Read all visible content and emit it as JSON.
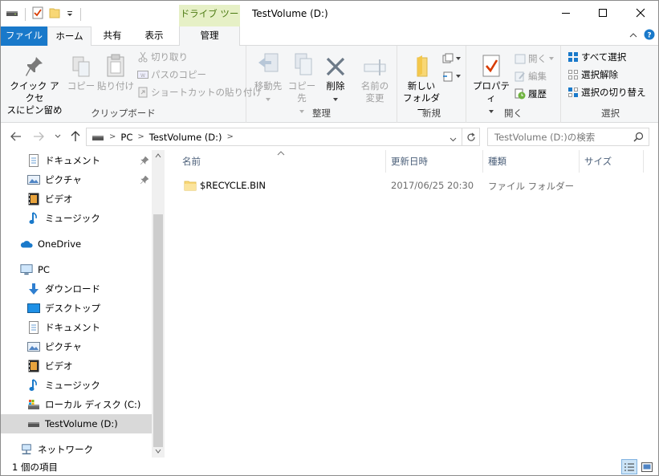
{
  "window": {
    "title": "TestVolume (D:)",
    "context_tab_title": "ドライブ ツール"
  },
  "tabs": {
    "file": "ファイル",
    "home": "ホーム",
    "share": "共有",
    "view": "表示",
    "manage": "管理"
  },
  "ribbon": {
    "clipboard": {
      "label": "クリップボード",
      "pin_quick_access": [
        "クイック アクセ",
        "スにピン留め"
      ],
      "copy": "コピー",
      "paste": "貼り付け",
      "cut": "切り取り",
      "copy_path": "パスのコピー",
      "paste_shortcut": "ショートカットの貼り付け"
    },
    "organize": {
      "label": "整理",
      "move_to": "移動先",
      "copy_to": "コピー先",
      "delete": "削除",
      "rename": [
        "名前の",
        "変更"
      ]
    },
    "new": {
      "label": "新規",
      "new_folder": [
        "新しい",
        "フォルダー"
      ]
    },
    "open": {
      "label": "開く",
      "properties": "プロパティ",
      "open": "開く",
      "edit": "編集",
      "history": "履歴"
    },
    "select": {
      "label": "選択",
      "select_all": "すべて選択",
      "select_none": "選択解除",
      "invert": "選択の切り替え"
    }
  },
  "address": {
    "crumbs": [
      "PC",
      "TestVolume (D:)"
    ],
    "search_placeholder": "TestVolume (D:)の検索"
  },
  "nav": {
    "items": [
      {
        "label": "ドキュメント",
        "icon": "document-icon"
      },
      {
        "label": "ピクチャ",
        "icon": "picture-icon"
      },
      {
        "label": "ビデオ",
        "icon": "video-icon"
      },
      {
        "label": "ミュージック",
        "icon": "music-icon"
      },
      {
        "label": "OneDrive",
        "icon": "onedrive-icon"
      },
      {
        "label": "PC",
        "icon": "pc-icon"
      },
      {
        "label": "ダウンロード",
        "icon": "download-icon"
      },
      {
        "label": "デスクトップ",
        "icon": "desktop-icon"
      },
      {
        "label": "ドキュメント",
        "icon": "document-icon"
      },
      {
        "label": "ピクチャ",
        "icon": "picture-icon"
      },
      {
        "label": "ビデオ",
        "icon": "video-icon"
      },
      {
        "label": "ミュージック",
        "icon": "music-icon"
      },
      {
        "label": "ローカル ディスク (C:)",
        "icon": "local-disk-icon"
      },
      {
        "label": "TestVolume (D:)",
        "icon": "drive-icon"
      },
      {
        "label": "ネットワーク",
        "icon": "network-icon"
      }
    ],
    "selected": "TestVolume (D:)"
  },
  "columns": {
    "name": "名前",
    "modified": "更新日時",
    "type": "種類",
    "size": "サイズ"
  },
  "files": [
    {
      "name": "$RECYCLE.BIN",
      "modified": "2017/06/25 20:30",
      "type": "ファイル フォルダー",
      "size": ""
    }
  ],
  "status": {
    "count": "1 個の項目"
  },
  "colors": {
    "file_tab": "#1979ca",
    "context_tab": "#e6f0c6",
    "context_text": "#4b7a12",
    "folder": "#f8d775",
    "selection": "#d9d9d9"
  }
}
